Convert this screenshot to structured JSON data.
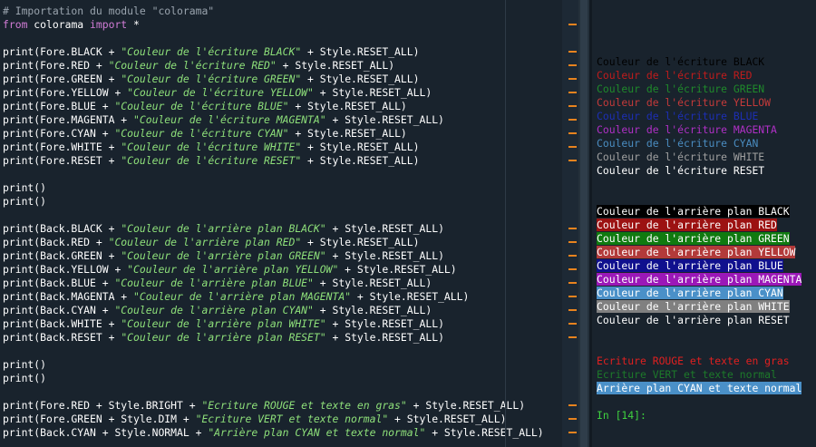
{
  "editor": {
    "lines": [
      [
        {
          "t": "# Importation du module \"colorama\"",
          "c": "comment"
        }
      ],
      [
        {
          "t": "from",
          "c": "kw"
        },
        {
          "t": " colorama ",
          "c": "punc"
        },
        {
          "t": "import",
          "c": "kw"
        },
        {
          "t": " *",
          "c": "punc"
        }
      ],
      [],
      [
        {
          "t": "print(Fore.BLACK + ",
          "c": "punc"
        },
        {
          "t": "\"Couleur de l'écriture BLACK\"",
          "c": "str"
        },
        {
          "t": " + Style.RESET_ALL)",
          "c": "punc"
        }
      ],
      [
        {
          "t": "print(Fore.RED + ",
          "c": "punc"
        },
        {
          "t": "\"Couleur de l'écriture RED\"",
          "c": "str"
        },
        {
          "t": " + Style.RESET_ALL)",
          "c": "punc"
        }
      ],
      [
        {
          "t": "print(Fore.GREEN + ",
          "c": "punc"
        },
        {
          "t": "\"Couleur de l'écriture GREEN\"",
          "c": "str"
        },
        {
          "t": " + Style.RESET_ALL)",
          "c": "punc"
        }
      ],
      [
        {
          "t": "print(Fore.YELLOW + ",
          "c": "punc"
        },
        {
          "t": "\"Couleur de l'écriture YELLOW\"",
          "c": "str"
        },
        {
          "t": " + Style.RESET_ALL)",
          "c": "punc"
        }
      ],
      [
        {
          "t": "print(Fore.BLUE + ",
          "c": "punc"
        },
        {
          "t": "\"Couleur de l'écriture BLUE\"",
          "c": "str"
        },
        {
          "t": " + Style.RESET_ALL)",
          "c": "punc"
        }
      ],
      [
        {
          "t": "print(Fore.MAGENTA + ",
          "c": "punc"
        },
        {
          "t": "\"Couleur de l'écriture MAGENTA\"",
          "c": "str"
        },
        {
          "t": " + Style.RESET_ALL)",
          "c": "punc"
        }
      ],
      [
        {
          "t": "print(Fore.CYAN + ",
          "c": "punc"
        },
        {
          "t": "\"Couleur de l'écriture CYAN\"",
          "c": "str"
        },
        {
          "t": " + Style.RESET_ALL)",
          "c": "punc"
        }
      ],
      [
        {
          "t": "print(Fore.WHITE + ",
          "c": "punc"
        },
        {
          "t": "\"Couleur de l'écriture WHITE\"",
          "c": "str"
        },
        {
          "t": " + Style.RESET_ALL)",
          "c": "punc"
        }
      ],
      [
        {
          "t": "print(Fore.RESET + ",
          "c": "punc"
        },
        {
          "t": "\"Couleur de l'écriture RESET\"",
          "c": "str"
        },
        {
          "t": " + Style.RESET_ALL)",
          "c": "punc"
        }
      ],
      [],
      [
        {
          "t": "print()",
          "c": "punc"
        }
      ],
      [
        {
          "t": "print()",
          "c": "punc"
        }
      ],
      [],
      [
        {
          "t": "print(Back.BLACK + ",
          "c": "punc"
        },
        {
          "t": "\"Couleur de l'arrière plan BLACK\"",
          "c": "str"
        },
        {
          "t": " + Style.RESET_ALL)",
          "c": "punc"
        }
      ],
      [
        {
          "t": "print(Back.RED + ",
          "c": "punc"
        },
        {
          "t": "\"Couleur de l'arrière plan RED\"",
          "c": "str"
        },
        {
          "t": " + Style.RESET_ALL)",
          "c": "punc"
        }
      ],
      [
        {
          "t": "print(Back.GREEN + ",
          "c": "punc"
        },
        {
          "t": "\"Couleur de l'arrière plan GREEN\"",
          "c": "str"
        },
        {
          "t": " + Style.RESET_ALL)",
          "c": "punc"
        }
      ],
      [
        {
          "t": "print(Back.YELLOW + ",
          "c": "punc"
        },
        {
          "t": "\"Couleur de l'arrière plan YELLOW\"",
          "c": "str"
        },
        {
          "t": " + Style.RESET_ALL)",
          "c": "punc"
        }
      ],
      [
        {
          "t": "print(Back.BLUE + ",
          "c": "punc"
        },
        {
          "t": "\"Couleur de l'arrière plan BLUE\"",
          "c": "str"
        },
        {
          "t": " + Style.RESET_ALL)",
          "c": "punc"
        }
      ],
      [
        {
          "t": "print(Back.MAGENTA + ",
          "c": "punc"
        },
        {
          "t": "\"Couleur de l'arrière plan MAGENTA\"",
          "c": "str"
        },
        {
          "t": " + Style.RESET_ALL)",
          "c": "punc"
        }
      ],
      [
        {
          "t": "print(Back.CYAN + ",
          "c": "punc"
        },
        {
          "t": "\"Couleur de l'arrière plan CYAN\"",
          "c": "str"
        },
        {
          "t": " + Style.RESET_ALL)",
          "c": "punc"
        }
      ],
      [
        {
          "t": "print(Back.WHITE + ",
          "c": "punc"
        },
        {
          "t": "\"Couleur de l'arrière plan WHITE\"",
          "c": "str"
        },
        {
          "t": " + Style.RESET_ALL)",
          "c": "punc"
        }
      ],
      [
        {
          "t": "print(Back.RESET + ",
          "c": "punc"
        },
        {
          "t": "\"Couleur de l'arrière plan RESET\"",
          "c": "str"
        },
        {
          "t": " + Style.RESET_ALL)",
          "c": "punc"
        }
      ],
      [],
      [
        {
          "t": "print()",
          "c": "punc"
        }
      ],
      [
        {
          "t": "print()",
          "c": "punc"
        }
      ],
      [],
      [
        {
          "t": "print(Fore.RED + Style.BRIGHT + ",
          "c": "punc"
        },
        {
          "t": "\"Ecriture ROUGE et texte en gras\"",
          "c": "str"
        },
        {
          "t": " + Style.RESET_ALL)",
          "c": "punc"
        }
      ],
      [
        {
          "t": "print(Fore.GREEN + Style.DIM + ",
          "c": "punc"
        },
        {
          "t": "\"Ecriture VERT et texte normal\"",
          "c": "str"
        },
        {
          "t": " + Style.RESET_ALL)",
          "c": "punc"
        }
      ],
      [
        {
          "t": "print(Back.CYAN + Style.NORMAL + ",
          "c": "punc"
        },
        {
          "t": "\"Arrière plan CYAN et texte normal\"",
          "c": "str"
        },
        {
          "t": " + Style.RESET_ALL)",
          "c": "punc"
        }
      ]
    ],
    "warning_line_indices": [
      1,
      3,
      4,
      5,
      6,
      7,
      8,
      9,
      10,
      11,
      16,
      17,
      18,
      19,
      20,
      21,
      22,
      23,
      24,
      29,
      30,
      31
    ]
  },
  "console": {
    "lines": [
      [],
      [],
      [
        {
          "t": "Couleur de l'écriture BLACK",
          "fg": "#000000"
        }
      ],
      [
        {
          "t": "Couleur de l'écriture RED",
          "fg": "#c01c1c"
        }
      ],
      [
        {
          "t": "Couleur de l'écriture GREEN",
          "fg": "#1f8a2b"
        }
      ],
      [
        {
          "t": "Couleur de l'écriture YELLOW",
          "fg": "#c43a3a"
        }
      ],
      [
        {
          "t": "Couleur de l'écriture BLUE",
          "fg": "#1d2fb5"
        }
      ],
      [
        {
          "t": "Couleur de l'écriture MAGENTA",
          "fg": "#b030c6"
        }
      ],
      [
        {
          "t": "Couleur de l'écriture CYAN",
          "fg": "#4a8cc0"
        }
      ],
      [
        {
          "t": "Couleur de l'écriture WHITE",
          "fg": "#a0a0a0"
        }
      ],
      [
        {
          "t": "Couleur de l'écriture RESET",
          "fg": "#ffffff"
        }
      ],
      [],
      [],
      [
        {
          "t": "Couleur de l'arrière plan BLACK",
          "fg": "#ffffff",
          "bg": "#000000"
        }
      ],
      [
        {
          "t": "Couleur de l'arrière plan RED",
          "fg": "#ffffff",
          "bg": "#9c1212"
        }
      ],
      [
        {
          "t": "Couleur de l'arrière plan GREEN",
          "fg": "#ffffff",
          "bg": "#107a10"
        }
      ],
      [
        {
          "t": "Couleur de l'arrière plan YELLOW",
          "fg": "#ffffff",
          "bg": "#b23a3a"
        }
      ],
      [
        {
          "t": "Couleur de l'arrière plan BLUE",
          "fg": "#ffffff",
          "bg": "#10108e"
        }
      ],
      [
        {
          "t": "Couleur de l'arrière plan MAGENTA",
          "fg": "#ffffff",
          "bg": "#9b18b8"
        }
      ],
      [
        {
          "t": "Couleur de l'arrière plan CYAN",
          "fg": "#ffffff",
          "bg": "#4a90c8"
        }
      ],
      [
        {
          "t": "Couleur de l'arrière plan WHITE",
          "fg": "#ffffff",
          "bg": "#808080"
        }
      ],
      [
        {
          "t": "Couleur de l'arrière plan RESET",
          "fg": "#ffffff"
        }
      ],
      [],
      [],
      [
        {
          "t": "Ecriture ROUGE et texte en gras",
          "fg": "#e02020"
        }
      ],
      [
        {
          "t": "Ecriture VERT et texte normal",
          "fg": "#1d7a2a"
        }
      ],
      [
        {
          "t": "Arrière plan CYAN et texte normal",
          "fg": "#ffffff",
          "bg": "#4a90c8"
        }
      ],
      [],
      [
        {
          "t": "In [14]:",
          "fg": "#3fd23f"
        }
      ]
    ]
  },
  "colors": {
    "editor_bg": "#19232d",
    "warning_marker": "#e8831e"
  }
}
